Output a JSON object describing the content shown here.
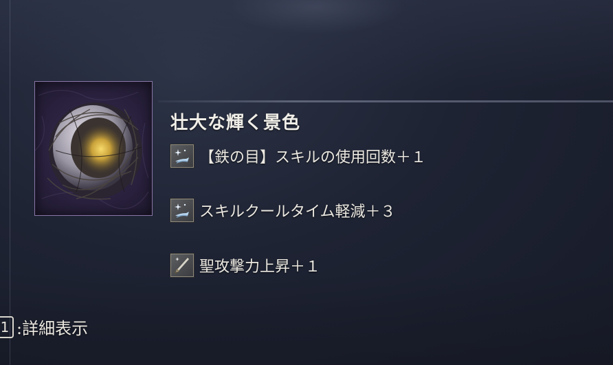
{
  "item": {
    "name": "壮大な輝く景色",
    "icon": "nest-relic-icon",
    "frame_color": "#8a76a8"
  },
  "effects": [
    {
      "icon": "sparkle-hand-icon",
      "text": "【鉄の目】スキルの使用回数＋１"
    },
    {
      "icon": "sparkle-hand-icon",
      "text": "スキルクールタイム軽減＋３"
    },
    {
      "icon": "sword-icon",
      "text": "聖攻撃力上昇＋１"
    }
  ],
  "footer": {
    "key": "1",
    "label": ":詳細表示"
  }
}
